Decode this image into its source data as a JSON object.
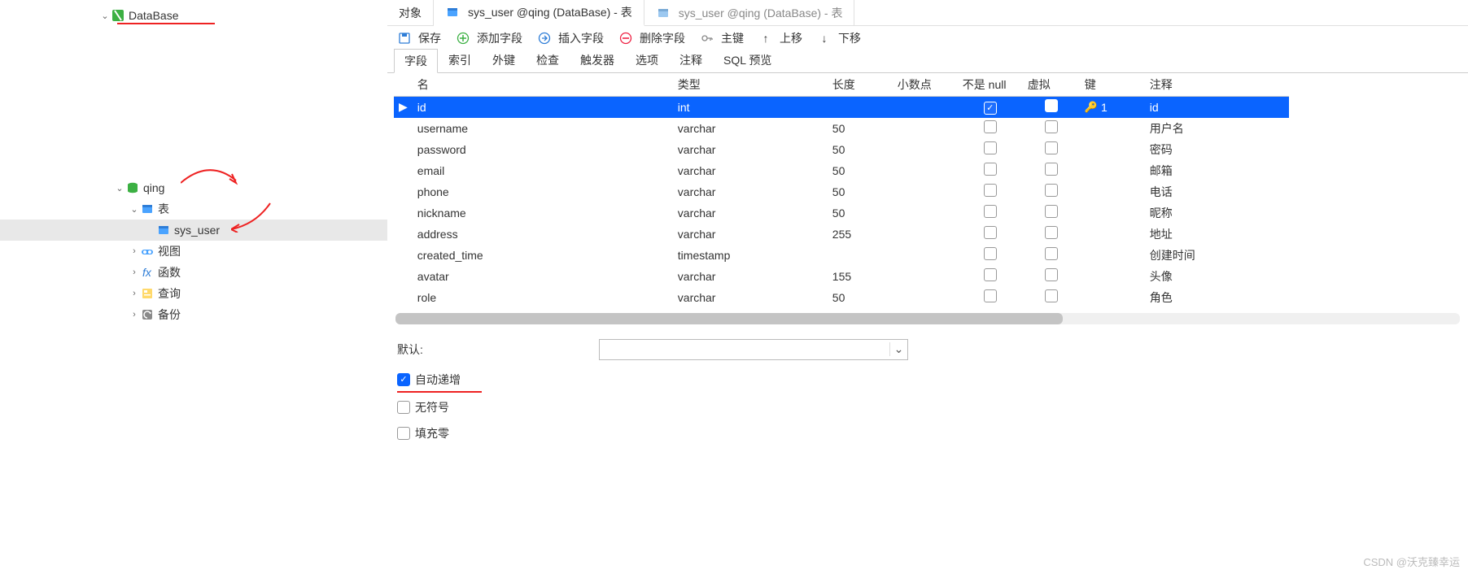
{
  "tree": {
    "root": "DataBase",
    "db": "qing",
    "nodes": {
      "tables": "表",
      "table_item": "sys_user",
      "views": "视图",
      "functions": "函数",
      "queries": "查询",
      "backups": "备份"
    }
  },
  "tabs": {
    "objects": "对象",
    "active": "sys_user @qing (DataBase) - 表",
    "inactive": "sys_user @qing (DataBase) - 表"
  },
  "toolbar": {
    "save": "保存",
    "add_field": "添加字段",
    "insert_field": "插入字段",
    "delete_field": "删除字段",
    "primary_key": "主键",
    "move_up": "上移",
    "move_down": "下移"
  },
  "subtabs": {
    "fields": "字段",
    "indexes": "索引",
    "fks": "外键",
    "checks": "检查",
    "triggers": "触发器",
    "options": "选项",
    "comments": "注释",
    "sql": "SQL 预览"
  },
  "columns": {
    "name": "名",
    "type": "类型",
    "length": "长度",
    "decimal": "小数点",
    "notnull": "不是 null",
    "virtual": "虚拟",
    "key": "键",
    "comment": "注释"
  },
  "rows": [
    {
      "name": "id",
      "type": "int",
      "len": "",
      "dec": "",
      "nn": true,
      "vir": false,
      "key": "1",
      "cmt": "id",
      "sel": true
    },
    {
      "name": "username",
      "type": "varchar",
      "len": "50",
      "dec": "",
      "nn": false,
      "vir": false,
      "key": "",
      "cmt": "用户名"
    },
    {
      "name": "password",
      "type": "varchar",
      "len": "50",
      "dec": "",
      "nn": false,
      "vir": false,
      "key": "",
      "cmt": "密码"
    },
    {
      "name": "email",
      "type": "varchar",
      "len": "50",
      "dec": "",
      "nn": false,
      "vir": false,
      "key": "",
      "cmt": "邮箱"
    },
    {
      "name": "phone",
      "type": "varchar",
      "len": "50",
      "dec": "",
      "nn": false,
      "vir": false,
      "key": "",
      "cmt": "电话"
    },
    {
      "name": "nickname",
      "type": "varchar",
      "len": "50",
      "dec": "",
      "nn": false,
      "vir": false,
      "key": "",
      "cmt": "昵称"
    },
    {
      "name": "address",
      "type": "varchar",
      "len": "255",
      "dec": "",
      "nn": false,
      "vir": false,
      "key": "",
      "cmt": "地址"
    },
    {
      "name": "created_time",
      "type": "timestamp",
      "len": "",
      "dec": "",
      "nn": false,
      "vir": false,
      "key": "",
      "cmt": "创建时间"
    },
    {
      "name": "avatar",
      "type": "varchar",
      "len": "155",
      "dec": "",
      "nn": false,
      "vir": false,
      "key": "",
      "cmt": "头像"
    },
    {
      "name": "role",
      "type": "varchar",
      "len": "50",
      "dec": "",
      "nn": false,
      "vir": false,
      "key": "",
      "cmt": "角色"
    }
  ],
  "form": {
    "default_label": "默认:",
    "default_value": "",
    "auto_inc": "自动递增",
    "unsigned": "无符号",
    "zerofill": "填充零"
  },
  "watermark": "CSDN @沃克臻幸运"
}
